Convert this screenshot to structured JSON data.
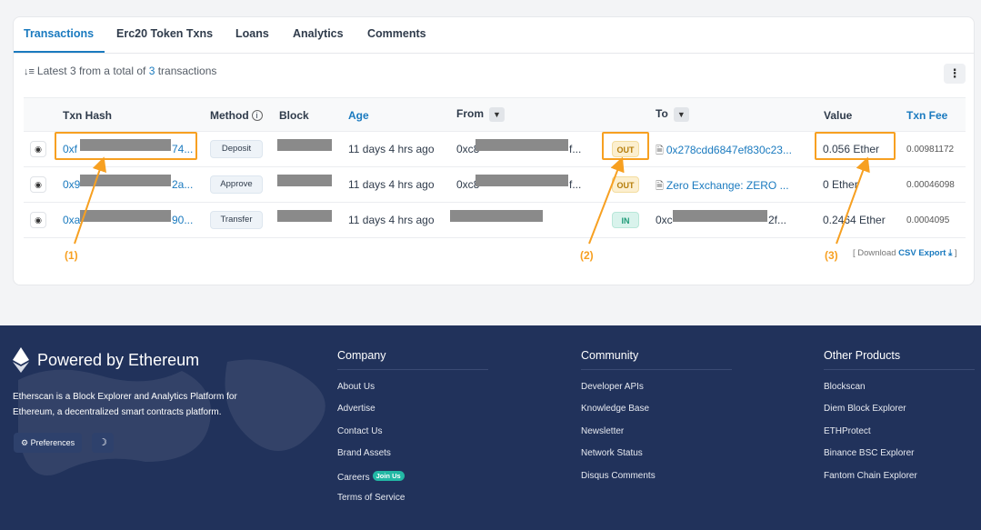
{
  "tabs": [
    "Transactions",
    "Erc20 Token Txns",
    "Loans",
    "Analytics",
    "Comments"
  ],
  "summary": {
    "prefix": "Latest ",
    "shown": "3",
    "middle": " from a total of ",
    "total": "3",
    "suffix": " transactions"
  },
  "more_icon": "kebab-menu-icon",
  "columns": {
    "txn_hash": "Txn Hash",
    "method": "Method",
    "block": "Block",
    "age": "Age",
    "from": "From",
    "to": "To",
    "value": "Value",
    "txn_fee": "Txn Fee"
  },
  "rows": [
    {
      "hash_start": "0xf",
      "hash_end": "74...",
      "method": "Deposit",
      "age": "11 days 4 hrs ago",
      "from_start": "0xc8",
      "from_end": "f...",
      "direction": "OUT",
      "to": "0x278cdd6847ef830c23...",
      "value": "0.056 Ether",
      "fee": "0.00981172"
    },
    {
      "hash_start": "0x9",
      "hash_end": "2a...",
      "method": "Approve",
      "age": "11 days 4 hrs ago",
      "from_start": "0xc8",
      "from_end": "f...",
      "direction": "OUT",
      "to": "Zero Exchange: ZERO ...",
      "value": "0 Ether",
      "fee": "0.00046098"
    },
    {
      "hash_start": "0xa",
      "hash_end": "90...",
      "method": "Transfer",
      "age": "11 days 4 hrs ago",
      "from_start": "",
      "from_end": "",
      "direction": "IN",
      "to_start": "0xc",
      "to_end": "2f...",
      "value": "0.2464 Ether",
      "fee": "0.0004095"
    }
  ],
  "callouts": [
    "(1)",
    "(2)",
    "(3)"
  ],
  "download": {
    "prefix": "[ Download ",
    "link": "CSV Export",
    "suffix": " ]"
  },
  "footer": {
    "brand": "Powered by Ethereum",
    "description": "Etherscan is a Block Explorer and Analytics Platform for Ethereum, a decentralized smart contracts platform.",
    "preferences": "Preferences",
    "company": {
      "title": "Company",
      "links": [
        "About Us",
        "Advertise",
        "Contact Us",
        "Brand Assets",
        "Careers",
        "Terms of Service"
      ],
      "careers_badge": "Join Us"
    },
    "community": {
      "title": "Community",
      "links": [
        "Developer APIs",
        "Knowledge Base",
        "Newsletter",
        "Network Status",
        "Disqus Comments"
      ]
    },
    "products": {
      "title": "Other Products",
      "links": [
        "Blockscan",
        "Diem Block Explorer",
        "ETHProtect",
        "Binance BSC Explorer",
        "Fantom Chain Explorer"
      ]
    }
  },
  "colors": {
    "accent": "#1a7abf",
    "highlight": "#f7a021",
    "footer_bg": "#21325b",
    "out": "#b57d0a",
    "in": "#1f9b78"
  }
}
